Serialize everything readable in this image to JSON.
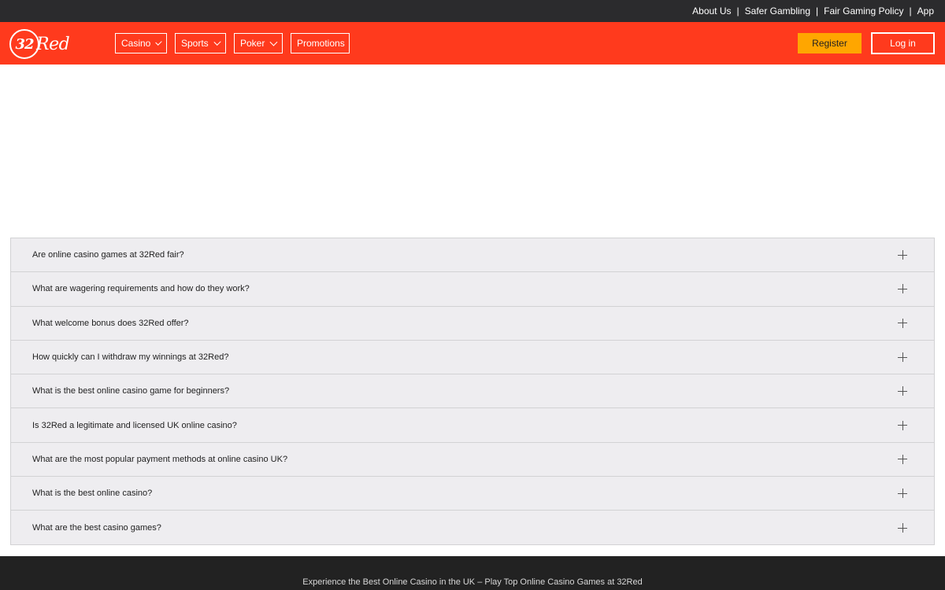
{
  "topbar": {
    "links": [
      "About Us",
      "Safer Gambling",
      "Fair Gaming Policy",
      "App"
    ],
    "separator": "|"
  },
  "brand": {
    "logo_number": "32",
    "logo_text": "Red",
    "color_primary": "#ff3a1d",
    "color_accent": "#ffa600"
  },
  "nav": {
    "casino": "Casino",
    "sports": "Sports",
    "poker": "Poker",
    "promotions": "Promotions",
    "register": "Register",
    "login": "Log in"
  },
  "faq": {
    "items": [
      "Are online casino games at 32Red fair?",
      "What are wagering requirements and how do they work?",
      "What welcome bonus does 32Red offer?",
      "How quickly can I withdraw my winnings at 32Red?",
      "What is the best online casino game for beginners?",
      "Is 32Red a legitimate and licensed UK online casino?",
      "What are the most popular payment methods at online casino UK?",
      "What is the best online casino?",
      "What are the best casino games?"
    ],
    "expand_icon": "plus-icon"
  },
  "footer": {
    "tagline": "Experience the Best Online Casino in the UK – Play Top Online Casino Games at 32Red"
  }
}
